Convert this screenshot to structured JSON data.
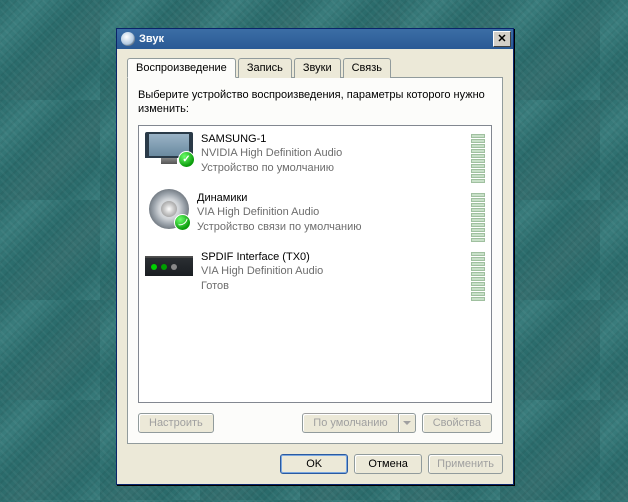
{
  "window": {
    "title": "Звук"
  },
  "tabs": [
    {
      "label": "Воспроизведение"
    },
    {
      "label": "Запись"
    },
    {
      "label": "Звуки"
    },
    {
      "label": "Связь"
    }
  ],
  "instruction": "Выберите устройство воспроизведения, параметры которого нужно изменить:",
  "devices": [
    {
      "name": "SAMSUNG-1",
      "driver": "NVIDIA High Definition Audio",
      "status": "Устройство по умолчанию",
      "icon": "monitor",
      "badge": "check"
    },
    {
      "name": "Динамики",
      "driver": "VIA High Definition Audio",
      "status": "Устройство связи по умолчанию",
      "icon": "speaker",
      "badge": "phone"
    },
    {
      "name": "SPDIF Interface (TX0)",
      "driver": "VIA High Definition Audio",
      "status": "Готов",
      "icon": "spdif",
      "badge": null
    }
  ],
  "panel_buttons": {
    "configure": "Настроить",
    "set_default": "По умолчанию",
    "properties": "Свойства"
  },
  "dialog_buttons": {
    "ok": "OK",
    "cancel": "Отмена",
    "apply": "Применить"
  }
}
